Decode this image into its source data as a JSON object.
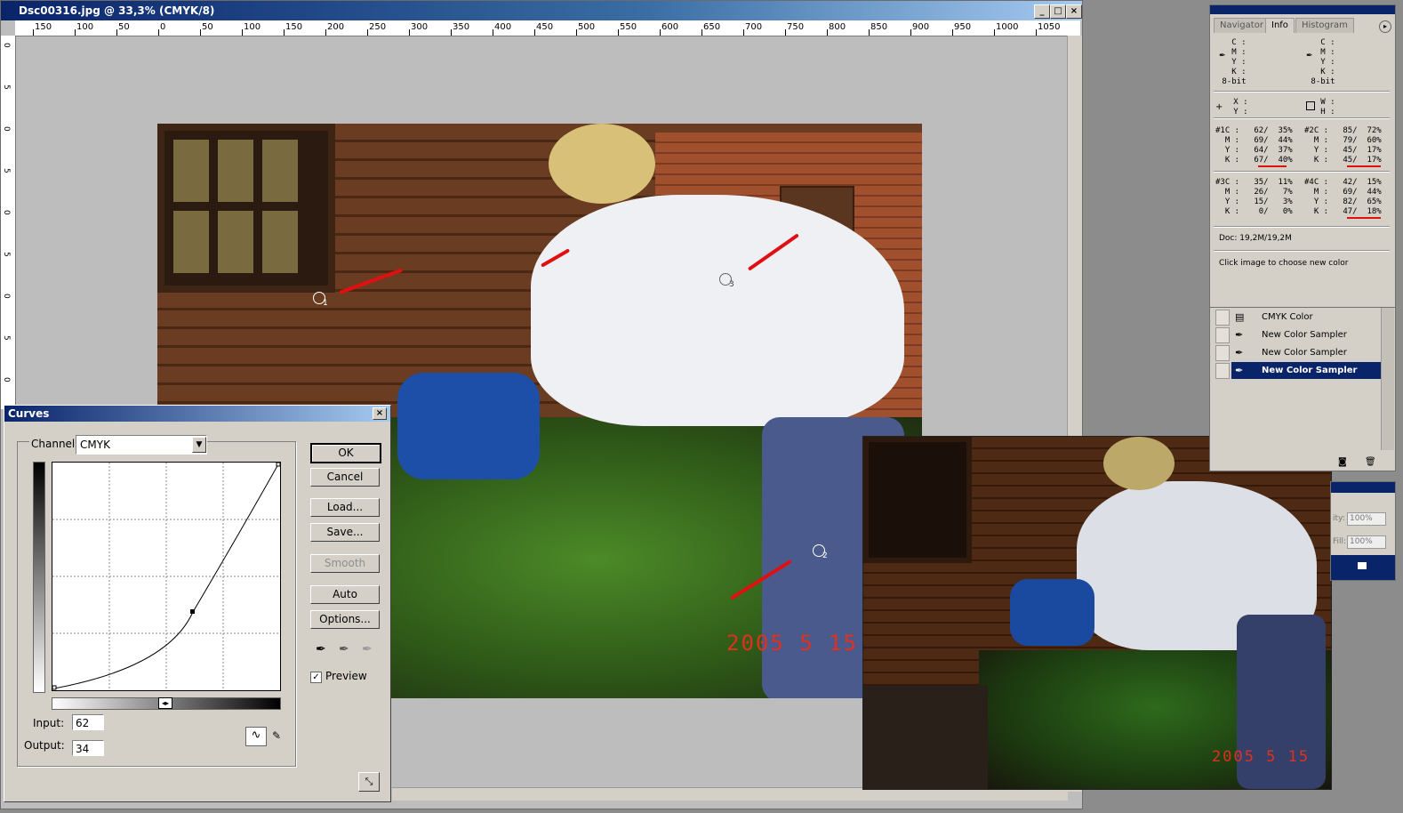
{
  "document": {
    "title": "Dsc00316.jpg @ 33,3% (CMYK/8)",
    "ruler_top": [
      "150",
      "100",
      "50",
      "0",
      "50",
      "100",
      "150",
      "200",
      "250",
      "300",
      "350",
      "400",
      "450",
      "500",
      "550",
      "600",
      "650",
      "700",
      "750",
      "800",
      "850",
      "900",
      "950",
      "1000",
      "1050"
    ],
    "ruler_left": [
      "0",
      "5",
      "0",
      "5",
      "0",
      "5",
      "0",
      "5",
      "0"
    ],
    "samplers": [
      "1",
      "2",
      "3"
    ],
    "date_stamp": "2005  5  15"
  },
  "preview": {
    "date_stamp": "2005  5  15"
  },
  "curves": {
    "title": "Curves",
    "channel_label": "Channel:",
    "channel_value": "CMYK",
    "buttons": {
      "ok": "OK",
      "cancel": "Cancel",
      "load": "Load...",
      "save": "Save...",
      "smooth": "Smooth",
      "auto": "Auto",
      "options": "Options..."
    },
    "preview_label": "Preview",
    "preview_checked": true,
    "input_label": "Input:",
    "input_value": "62",
    "output_label": "Output:",
    "output_value": "34"
  },
  "info_panel": {
    "tabs": [
      "Navigator",
      "Info",
      "Histogram"
    ],
    "active_tab": "Info",
    "block1_left": "   C :\n   M :\n   Y :\n   K :\n 8-bit",
    "block1_right": "   C :\n   M :\n   Y :\n   K :\n 8-bit",
    "block2_left": "   X :\n   Y :",
    "block2_right": "   W :\n   H :",
    "sampler1": "#1C :   62/  35%\n  M :   69/  44%\n  Y :   64/  37%\n  K :   67/  40%",
    "sampler2": "#2C :   85/  72%\n  M :   79/  60%\n  Y :   45/  17%\n  K :   45/  17%",
    "sampler3": "#3C :   35/  11%\n  M :   26/   7%\n  Y :   15/   3%\n  K :    0/   0%",
    "sampler4": "#4C :   42/  15%\n  M :   69/  44%\n  Y :   82/  65%\n  K :   47/  18%",
    "doc_size": "Doc: 19,2M/19,2M",
    "hint": "Click image to choose new color"
  },
  "history_panel": {
    "items": [
      {
        "label": "CMYK Color",
        "selected": false
      },
      {
        "label": "New Color Sampler",
        "selected": false
      },
      {
        "label": "New Color Sampler",
        "selected": false
      },
      {
        "label": "New Color Sampler",
        "selected": true
      }
    ]
  },
  "layers_panel": {
    "opacity_label": "ity:",
    "opacity_value": "100%",
    "fill_label": "Fill:",
    "fill_value": "100%"
  }
}
